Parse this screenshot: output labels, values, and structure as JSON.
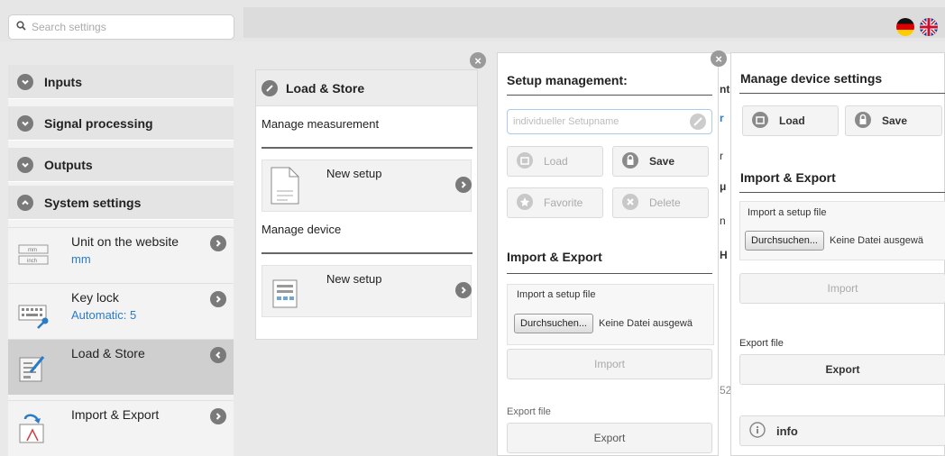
{
  "search": {
    "placeholder": "Search settings"
  },
  "languages": [
    {
      "name": "german-flag"
    },
    {
      "name": "uk-flag"
    }
  ],
  "sidebar": {
    "headers": [
      {
        "label": "Inputs",
        "state": "collapsed"
      },
      {
        "label": "Signal processing",
        "state": "collapsed"
      },
      {
        "label": "Outputs",
        "state": "collapsed"
      },
      {
        "label": "System settings",
        "state": "expanded"
      }
    ],
    "items": [
      {
        "label": "Unit on the website",
        "value": "mm",
        "icon": "unit-icon",
        "icon_text": [
          "mm",
          "inch"
        ]
      },
      {
        "label": "Key lock",
        "value": "Automatic: 5",
        "icon": "keyboard-key-icon"
      },
      {
        "label": "Load & Store",
        "value": "",
        "icon": "edit-document-icon",
        "selected": true
      },
      {
        "label": "Import & Export",
        "value": "",
        "icon": "import-export-icon"
      }
    ]
  },
  "load_store": {
    "title": "Load & Store",
    "sections": [
      {
        "label": "Manage measurement",
        "card": "New setup"
      },
      {
        "label": "Manage device",
        "card": "New setup"
      }
    ]
  },
  "setup_panel": {
    "title": "Setup management:",
    "name_placeholder": "individueller Setupname",
    "buttons": {
      "load": "Load",
      "save": "Save",
      "favorite": "Favorite",
      "delete": "Delete"
    },
    "import_title": "Import & Export",
    "import_label": "Import a setup file",
    "browse": "Durchsuchen...",
    "no_file": "Keine Datei ausgewä",
    "import_button": "Import",
    "export_label": "Export file",
    "export_button": "Export"
  },
  "device_panel": {
    "title": "Manage device settings",
    "buttons": {
      "load": "Load",
      "save": "Save"
    },
    "import_title": "Import & Export",
    "import_label": "Import a setup file",
    "browse": "Durchsuchen...",
    "no_file": "Keine Datei ausgewä",
    "import_button": "Import",
    "export_label": "Export file",
    "export_button": "Export",
    "info": "info"
  },
  "behind_text": [
    "nt",
    "r",
    "r",
    "μ",
    "n",
    "H",
    "52"
  ],
  "colors": {
    "accent": "#2b7bc6",
    "header_bg": "#e4e4e4",
    "selected_bg": "#cfcfcf"
  }
}
